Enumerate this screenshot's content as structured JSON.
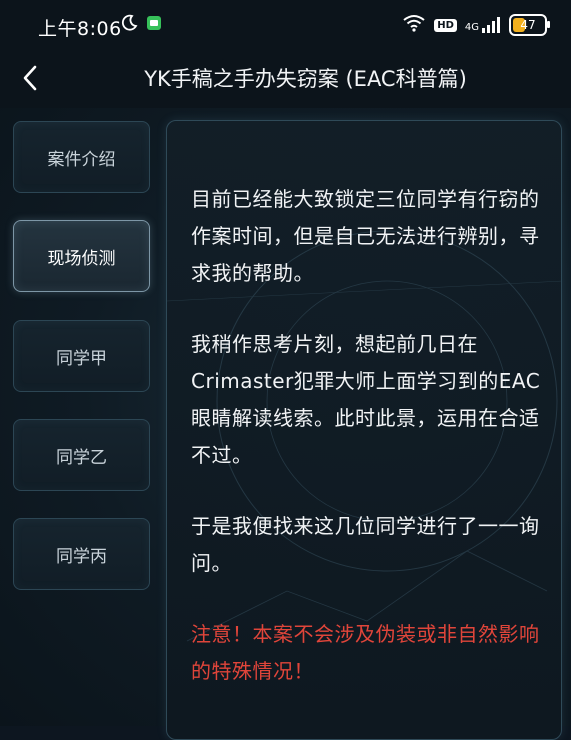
{
  "status_bar": {
    "time": "上午8:06",
    "hd": "HD",
    "network": "4G",
    "battery": "47",
    "battery_level": 0.47
  },
  "nav": {
    "title": "YK手稿之手办失窃案 (EAC科普篇)",
    "back_icon": "chevron-left-icon"
  },
  "sidebar": {
    "items": [
      {
        "label": "案件介绍"
      },
      {
        "label": "现场侦测"
      },
      {
        "label": "同学甲"
      },
      {
        "label": "同学乙"
      },
      {
        "label": "同学丙"
      }
    ],
    "active_index": 1
  },
  "content": {
    "paragraphs": [
      "目前已经能大致锁定三位同学有行窃的作案时间，但是自己无法进行辨别，寻求我的帮助。",
      "我稍作思考片刻，想起前几日在Crimaster犯罪大师上面学习到的EAC眼睛解读线索。此时此景，运用在合适不过。",
      "于是我便找来这几位同学进行了一一询问。"
    ],
    "warning": "注意！本案不会涉及伪装或非自然影响的特殊情况！"
  },
  "colors": {
    "warning": "#e0453a",
    "battery": "#f2b01e",
    "background": "#0d1620"
  }
}
